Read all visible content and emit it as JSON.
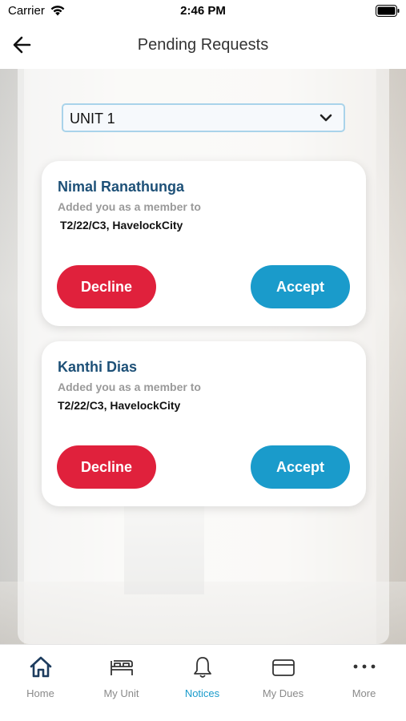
{
  "status_bar": {
    "carrier": "Carrier",
    "time": "2:46 PM"
  },
  "nav": {
    "title": "Pending Requests"
  },
  "unit_select": {
    "selected": "UNIT 1"
  },
  "requests": [
    {
      "name": "Nimal Ranathunga",
      "message": "Added you as a member to",
      "unit": "T2/22/C3, HavelockCity",
      "decline_label": "Decline",
      "accept_label": "Accept"
    },
    {
      "name": "Kanthi Dias",
      "message": "Added you as a member to",
      "unit": "T2/22/C3, HavelockCity",
      "decline_label": "Decline",
      "accept_label": "Accept"
    }
  ],
  "tabs": [
    {
      "label": "Home",
      "icon": "home-icon"
    },
    {
      "label": "My Unit",
      "icon": "bed-icon"
    },
    {
      "label": "Notices",
      "icon": "bell-icon",
      "active": true
    },
    {
      "label": "My Dues",
      "icon": "card-icon"
    },
    {
      "label": "More",
      "icon": "more-dots-icon"
    }
  ],
  "colors": {
    "accent": "#1a9bcb",
    "decline": "#e0213c",
    "name": "#1d5077",
    "dark_icon": "#1d3c5e"
  }
}
